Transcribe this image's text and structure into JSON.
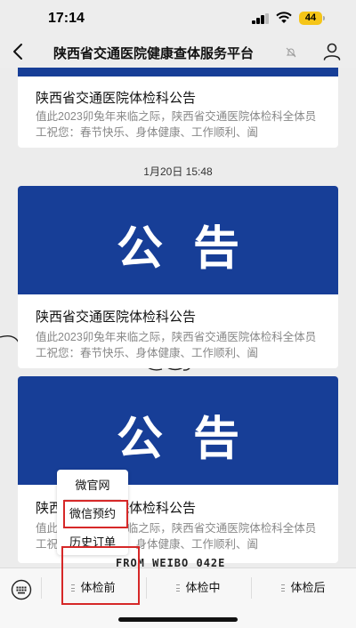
{
  "status_bar": {
    "time": "17:14",
    "battery": "44"
  },
  "nav": {
    "title": "陕西省交通医院健康查体服务平台"
  },
  "feed": {
    "timestamp": "1月20日 15:48",
    "articles": [
      {
        "title": "陕西省交通医院体检科公告",
        "desc": "值此2023卯兔年来临之际，陕西省交通医院体检科全体员工祝您：春节快乐、身体健康、工作顺利、阖"
      },
      {
        "cover_text": "公告",
        "title": "陕西省交通医院体检科公告",
        "desc": "值此2023卯兔年来临之际，陕西省交通医院体检科全体员工祝您：春节快乐、身体健康、工作顺利、阖"
      },
      {
        "cover_text": "公告",
        "title": "陕西省交通医院体检科公告",
        "desc": "值此2023卯兔年来临之际，陕西省交通医院体检科全体员工祝您：春节快乐、身体健康、工作顺利、阖"
      }
    ]
  },
  "watermark": "FROM WEIBO 042E",
  "popup_menu": {
    "items": [
      {
        "label": "微官网"
      },
      {
        "label": "微信预约"
      },
      {
        "label": "历史订单"
      }
    ]
  },
  "menu_bar": {
    "items": [
      {
        "label": "体检前"
      },
      {
        "label": "体检中"
      },
      {
        "label": "体检后"
      }
    ]
  },
  "colors": {
    "cover_blue": "#173e97",
    "highlight_red": "#d62828",
    "battery_yellow": "#f5c518"
  }
}
